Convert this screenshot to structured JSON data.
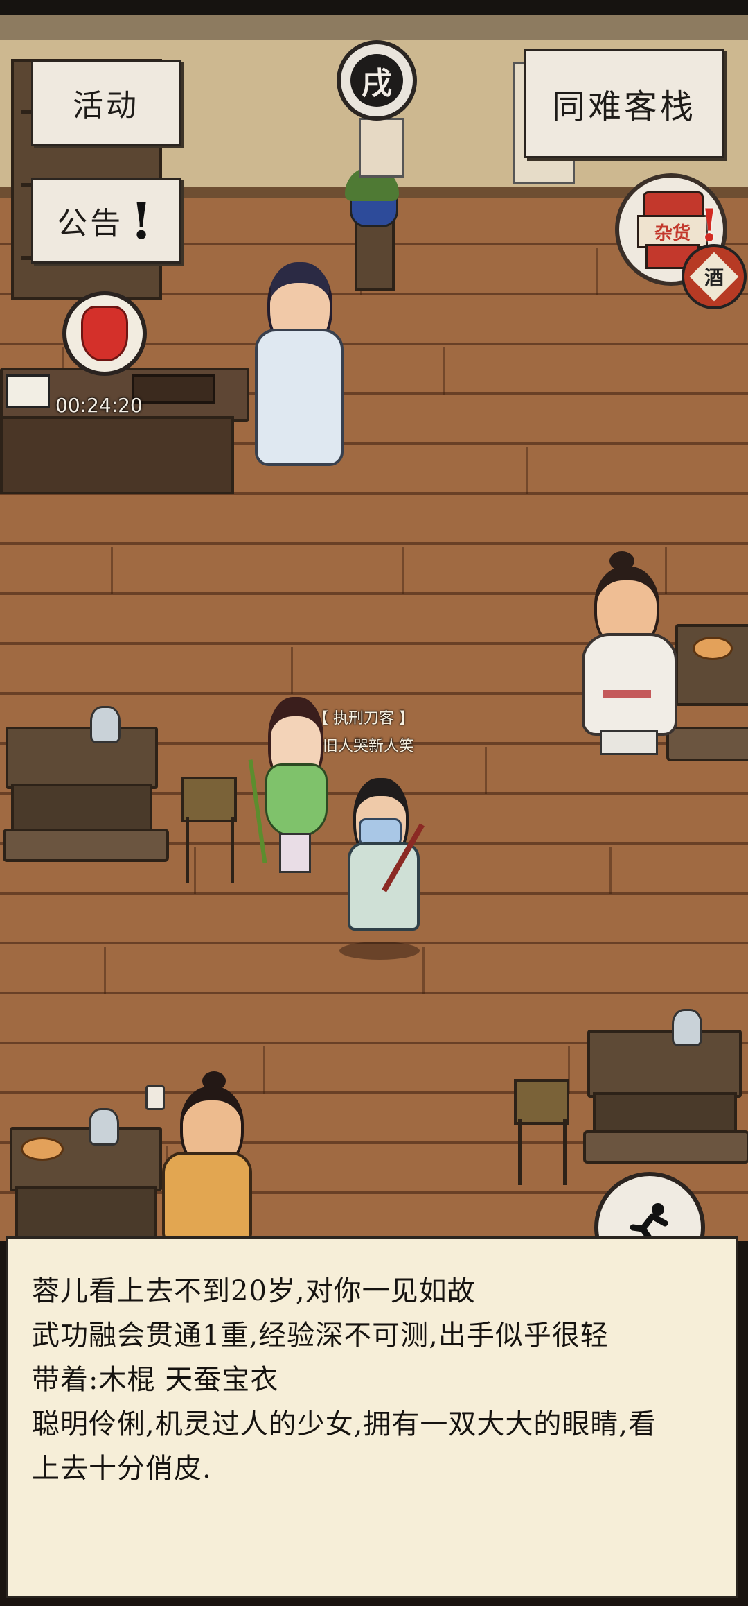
{
  "hud": {
    "activity_label": "活动",
    "notice_label": "公告",
    "inn_name": "同难客栈",
    "time_badge": "戌",
    "shop_sign": "杂货",
    "wine_sign": "酒",
    "gift_timer": "00:24:20",
    "alert_mark": "!"
  },
  "npc": {
    "title": "【 执刑刀客 】",
    "motto": "旧人哭新人笑"
  },
  "dialog": {
    "lines": [
      "蓉儿看上去不到20岁,对你一见如故",
      "武功融会贯通1重,经验深不可测,出手似乎很轻",
      "带着:木棍 天蚕宝衣",
      "聪明伶俐,机灵过人的少女,拥有一双大大的眼睛,看",
      "上去十分俏皮."
    ]
  },
  "colors": {
    "floor": "#a06a42",
    "wall": "#cdb890",
    "dialog_bg": "#f6eed8",
    "gift_red": "#d4302a"
  }
}
